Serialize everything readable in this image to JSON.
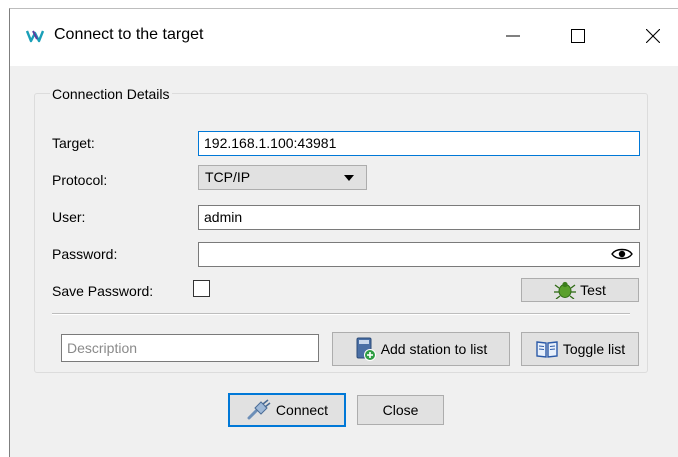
{
  "window": {
    "title": "Connect to the target",
    "logo_icon": "app-logo-icon",
    "controls": [
      "minimize-icon",
      "maximize-icon",
      "close-icon"
    ]
  },
  "group": {
    "legend": "Connection Details"
  },
  "form": {
    "target_label": "Target:",
    "target_value": "192.168.1.100:43981",
    "protocol_label": "Protocol:",
    "protocol_value": "TCP/IP",
    "user_label": "User:",
    "user_value": "admin",
    "password_label": "Password:",
    "password_value": "",
    "save_password_label": "Save Password:",
    "save_password_checked": false,
    "test_button": "Test"
  },
  "station": {
    "description_placeholder": "Description",
    "add_button": "Add station to list",
    "toggle_button": "Toggle list"
  },
  "footer": {
    "connect_button": "Connect",
    "close_button": "Close"
  },
  "colors": {
    "accent": "#0078d7",
    "dialog_bg": "#f0f0f0",
    "button_bg": "#e1e1e1"
  }
}
